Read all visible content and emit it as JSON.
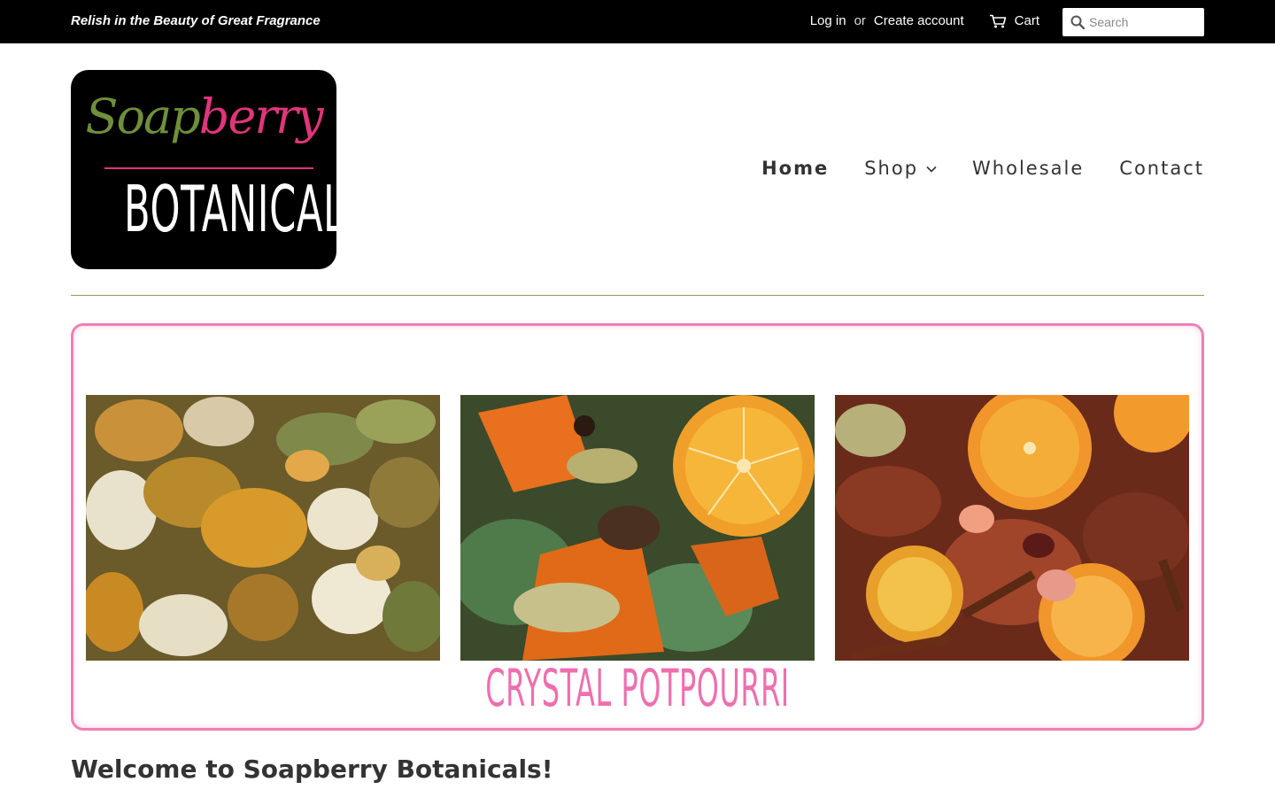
{
  "topbar": {
    "tagline": "Relish in the Beauty of Great Fragrance",
    "login_label": "Log in",
    "or_label": "or",
    "create_account_label": "Create account",
    "cart_label": "Cart",
    "search_placeholder": "Search",
    "icons": {
      "cart": "cart-icon",
      "search": "search-icon"
    }
  },
  "logo": {
    "script_part1": "Soap",
    "script_part2": "berry",
    "main_text": "BOTANICALS",
    "colors": {
      "green": "#6f8f3a",
      "pink": "#e0357a"
    }
  },
  "nav": {
    "items": [
      {
        "label": "Home",
        "active": true
      },
      {
        "label": "Shop",
        "has_dropdown": true
      },
      {
        "label": "Wholesale"
      },
      {
        "label": "Contact"
      }
    ]
  },
  "banner": {
    "caption": "CRYSTAL POTPOURRI",
    "border_color": "#ee80b4",
    "photos": [
      "potpourri-photo-1",
      "potpourri-photo-2",
      "potpourri-photo-3"
    ]
  },
  "main": {
    "welcome_heading": "Welcome to Soapberry Botanicals!"
  }
}
